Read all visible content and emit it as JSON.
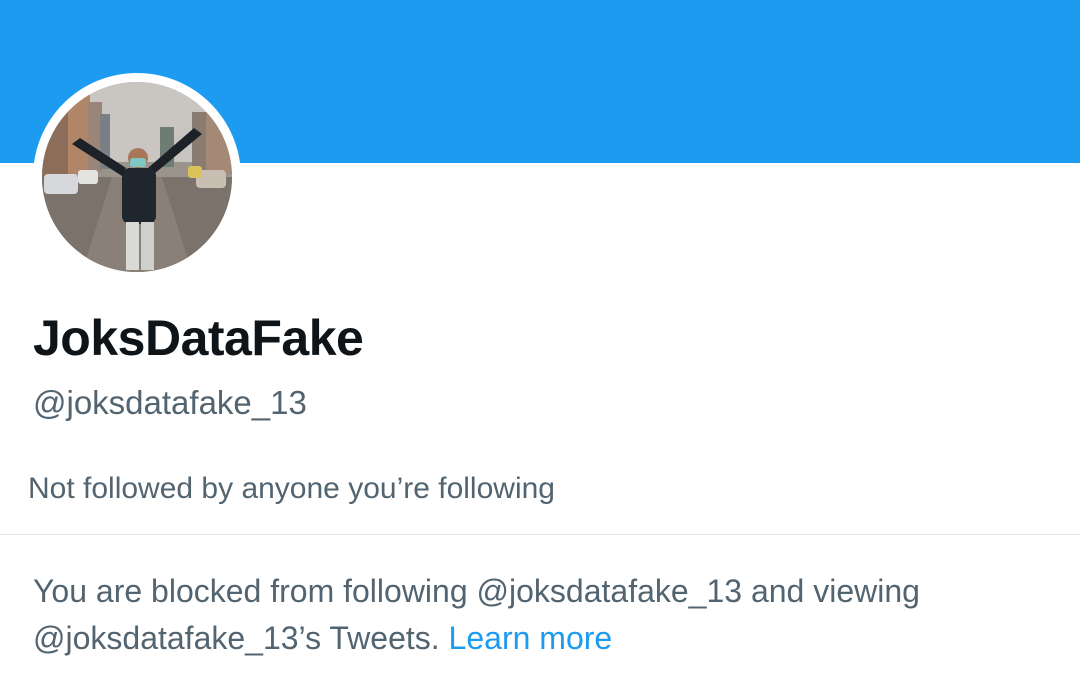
{
  "colors": {
    "banner": "#1d9bf0",
    "primary_text": "#0f1419",
    "secondary_text": "#536471",
    "link": "#1d9bf0"
  },
  "profile": {
    "display_name": "JoksDataFake",
    "handle": "@joksdatafake_13",
    "followers_you_know": "Not followed by anyone you’re following",
    "avatar_icon": "profile-photo"
  },
  "blocked_notice": {
    "line1": "You are blocked from following @joksdatafake_13 and viewing",
    "line2": "@joksdatafake_13’s Tweets.",
    "link_label": "Learn more"
  }
}
